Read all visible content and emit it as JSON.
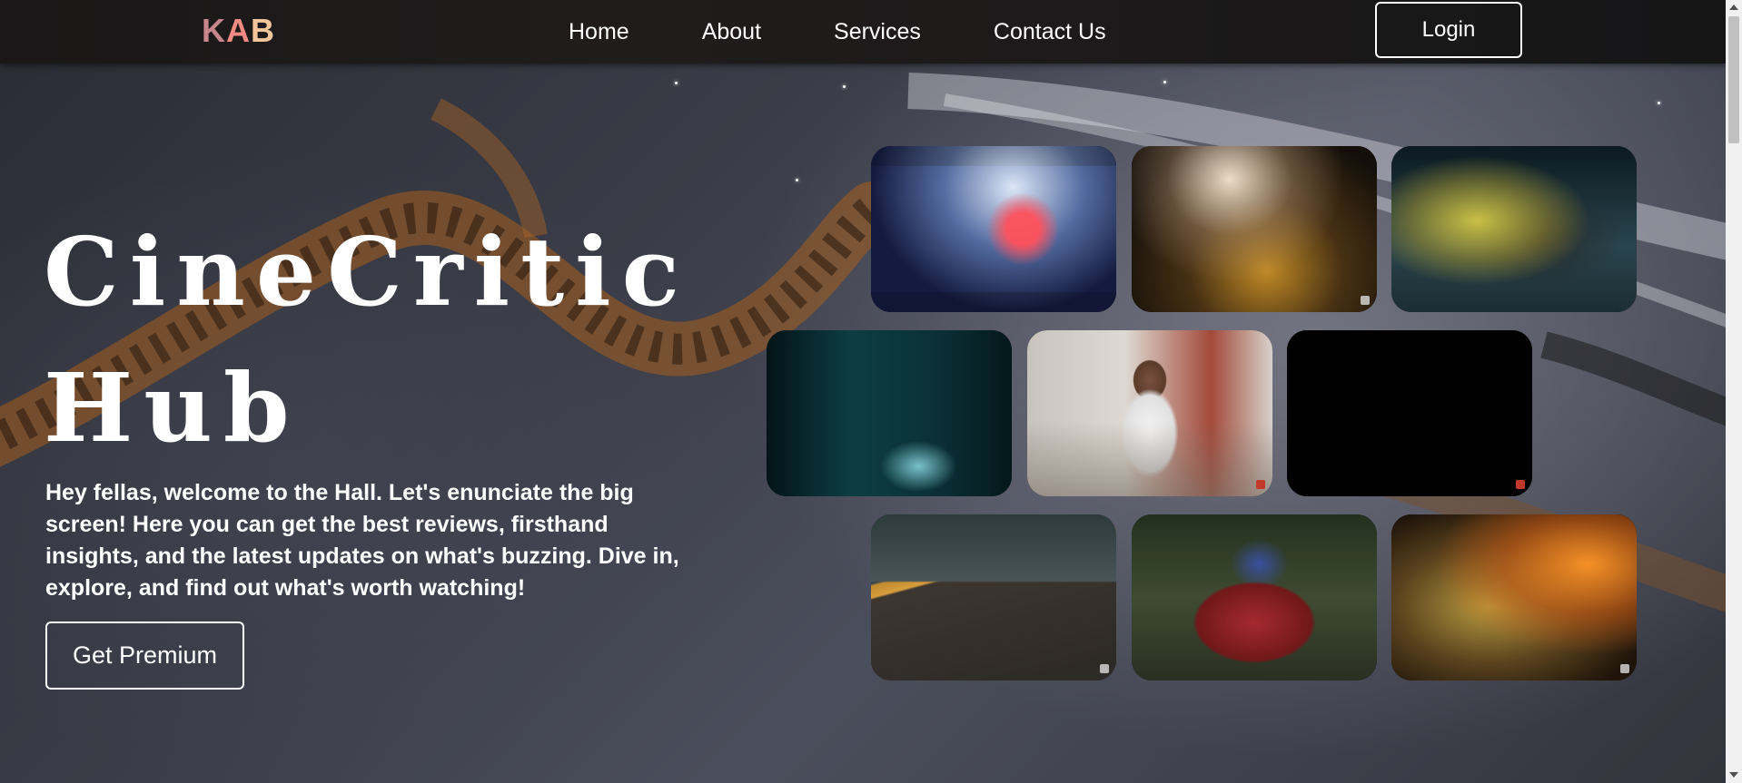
{
  "navbar": {
    "logo": [
      "K",
      "A",
      "B"
    ],
    "links": [
      "Home",
      "About",
      "Services",
      "Contact Us"
    ],
    "login_label": "Login"
  },
  "hero": {
    "title": "CineCritic Hub",
    "text": "Hey fellas, welcome to the Hall. Let's enunciate the big screen! Here you can get the best reviews, firsthand insights, and the latest updates on what's buzzing. Dive in, explore, and find out what's worth watching!",
    "cta_label": "Get Premium"
  },
  "colors": {
    "logo_k": "#c9858c",
    "logo_a": "#f08a82",
    "logo_b": "#f2c59a",
    "navbar_bg": "#1a1718",
    "text": "#ffffff"
  },
  "trailer_grid": {
    "rows": 3,
    "columns": 3,
    "tiles": [
      "video-thumbnail",
      "video-thumbnail",
      "video-thumbnail",
      "video-thumbnail",
      "video-thumbnail",
      "video-thumbnail",
      "video-thumbnail",
      "video-thumbnail",
      "video-thumbnail"
    ]
  }
}
